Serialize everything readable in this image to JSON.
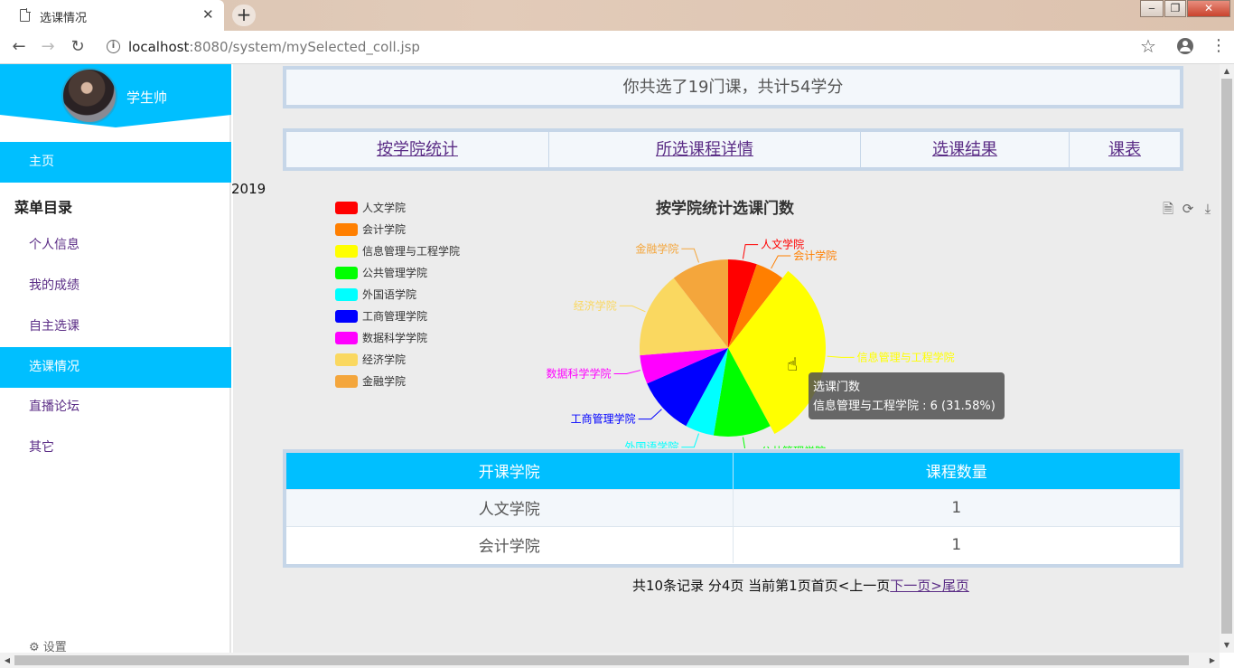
{
  "browser": {
    "tab_title": "选课情况",
    "tab_close": "✕",
    "new_tab": "+",
    "url_host": "localhost",
    "url_rest": ":8080/system/mySelected_coll.jsp",
    "win_minimize": "‒",
    "win_restore": "❐",
    "win_close": "✕"
  },
  "sidebar": {
    "user_name": "学生帅",
    "home": "主页",
    "menu_heading": "菜单目录",
    "items": [
      {
        "label": "个人信息"
      },
      {
        "label": "我的成绩"
      },
      {
        "label": "自主选课"
      },
      {
        "label": "选课情况"
      },
      {
        "label": "直播论坛"
      },
      {
        "label": "其它"
      }
    ],
    "settings": "设置",
    "colors": {
      "accent": "#00bfff",
      "link": "#5b2d86"
    }
  },
  "main": {
    "summary": "你共选了19门课，共计54学分",
    "links": [
      {
        "label": "按学院统计"
      },
      {
        "label": "所选课程详情"
      },
      {
        "label": "选课结果"
      },
      {
        "label": "课表"
      }
    ],
    "year": "2019",
    "tooltip": {
      "title": "选课门数",
      "detail": "信息管理与工程学院 : 6 (31.58%)"
    },
    "table": {
      "headers": [
        "开课学院",
        "课程数量"
      ],
      "rows": [
        {
          "college": "人文学院",
          "count": "1"
        },
        {
          "college": "会计学院",
          "count": "1"
        }
      ]
    },
    "pager": {
      "info": "共10条记录 分4页 当前第1页首页<上一页",
      "next": "下一页>",
      "last": "尾页"
    }
  },
  "chart_data": {
    "type": "pie",
    "title": "按学院统计选课门数",
    "series_name": "选课门数",
    "categories": [
      "人文学院",
      "会计学院",
      "信息管理与工程学院",
      "公共管理学院",
      "外国语学院",
      "工商管理学院",
      "数据科学学院",
      "经济学院",
      "金融学院"
    ],
    "values": [
      1,
      1,
      6,
      2,
      1,
      2,
      1,
      3,
      2
    ],
    "colors": [
      "#ff0000",
      "#ff7f00",
      "#ffff00",
      "#00ff00",
      "#00ffff",
      "#0000ff",
      "#ff00ff",
      "#fad860",
      "#f4a63c"
    ],
    "legend_position": "left"
  }
}
